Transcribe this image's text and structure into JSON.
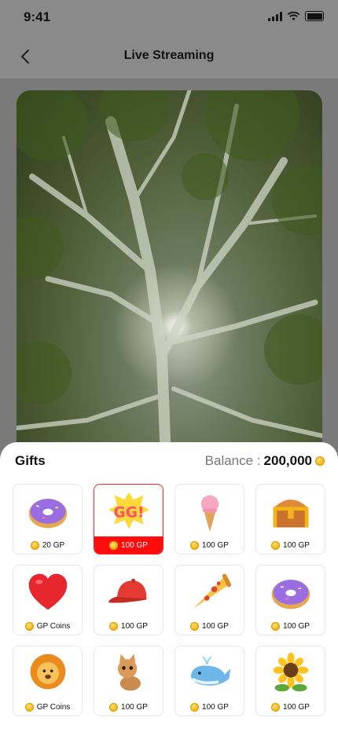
{
  "status": {
    "time": "9:41"
  },
  "header": {
    "title": "Live Streaming"
  },
  "gifts": {
    "title": "Gifts",
    "balance_label": "Balance :",
    "balance_value": "200,000",
    "items": [
      {
        "name": "donut",
        "price": "20 GP",
        "selected": false
      },
      {
        "name": "gg",
        "price": "100 GP",
        "selected": true
      },
      {
        "name": "ice-cream",
        "price": "100 GP",
        "selected": false
      },
      {
        "name": "treasure-chest",
        "price": "100 GP",
        "selected": false
      },
      {
        "name": "heart",
        "price": "GP Coins",
        "selected": false
      },
      {
        "name": "cap",
        "price": "100 GP",
        "selected": false
      },
      {
        "name": "pizza",
        "price": "100 GP",
        "selected": false
      },
      {
        "name": "donut",
        "price": "100 GP",
        "selected": false
      },
      {
        "name": "lion",
        "price": "GP Coins",
        "selected": false
      },
      {
        "name": "cat",
        "price": "100 GP",
        "selected": false
      },
      {
        "name": "whale",
        "price": "100 GP",
        "selected": false
      },
      {
        "name": "sunflower",
        "price": "100 GP",
        "selected": false
      }
    ]
  },
  "colors": {
    "selected": "#ff0d0d",
    "coin": "#f3b515"
  }
}
